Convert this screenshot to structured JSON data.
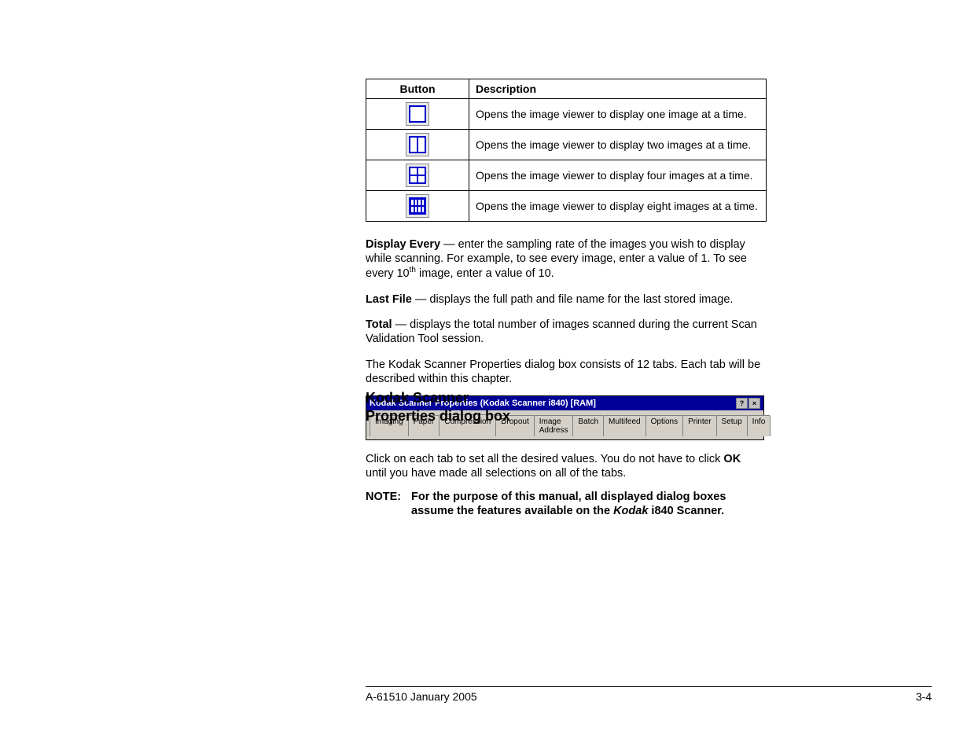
{
  "table": {
    "headers": {
      "button": "Button",
      "description": "Description"
    },
    "rows": [
      {
        "icon": "one-image-icon",
        "desc": "Opens the image viewer to display one image at a time."
      },
      {
        "icon": "two-image-icon",
        "desc": "Opens the image viewer to display two images at a time."
      },
      {
        "icon": "four-image-icon",
        "desc": "Opens the image viewer to display four images at a time."
      },
      {
        "icon": "eight-image-icon",
        "desc": "Opens the image viewer to display eight images at a time."
      }
    ]
  },
  "display_every": {
    "label": "Display Every",
    "text_before": " — enter the sampling rate of the images you wish to display while scanning. For example, to see every image, enter a value of 1. To see every 10",
    "sup": "th",
    "text_after": " image, enter a value of 10."
  },
  "last_file": {
    "label": "Last File",
    "text": " — displays the full path and file name for the last stored image."
  },
  "total": {
    "label": "Total",
    "text": " — displays the total number of images scanned during the current Scan Validation Tool session."
  },
  "section_heading": "Kodak Scanner Properties dialog box",
  "intro": "The Kodak Scanner Properties dialog box consists of 12 tabs. Each tab will be described within this chapter.",
  "dialog": {
    "title": "Kodak Scanner Properties (Kodak Scanner i840) [RAM]",
    "help": "?",
    "close": "×",
    "tabs": [
      "Imaging",
      "Paper",
      "Compression",
      "Dropout",
      "Image Address",
      "Batch",
      "Multifeed",
      "Options",
      "Printer",
      "Setup",
      "Info"
    ],
    "active_tab": "Compression"
  },
  "click_text": {
    "before": "Click on each tab to set all the desired values. You do not have to click ",
    "ok": "OK",
    "after": " until you have made all selections on all of the tabs."
  },
  "note": {
    "label": "NOTE:",
    "before": "For the purpose of this manual, all displayed dialog boxes assume the features available on the ",
    "italic": "Kodak",
    "after": " i840 Scanner."
  },
  "footer": {
    "left": "A-61510 January 2005",
    "right": "3-4"
  }
}
